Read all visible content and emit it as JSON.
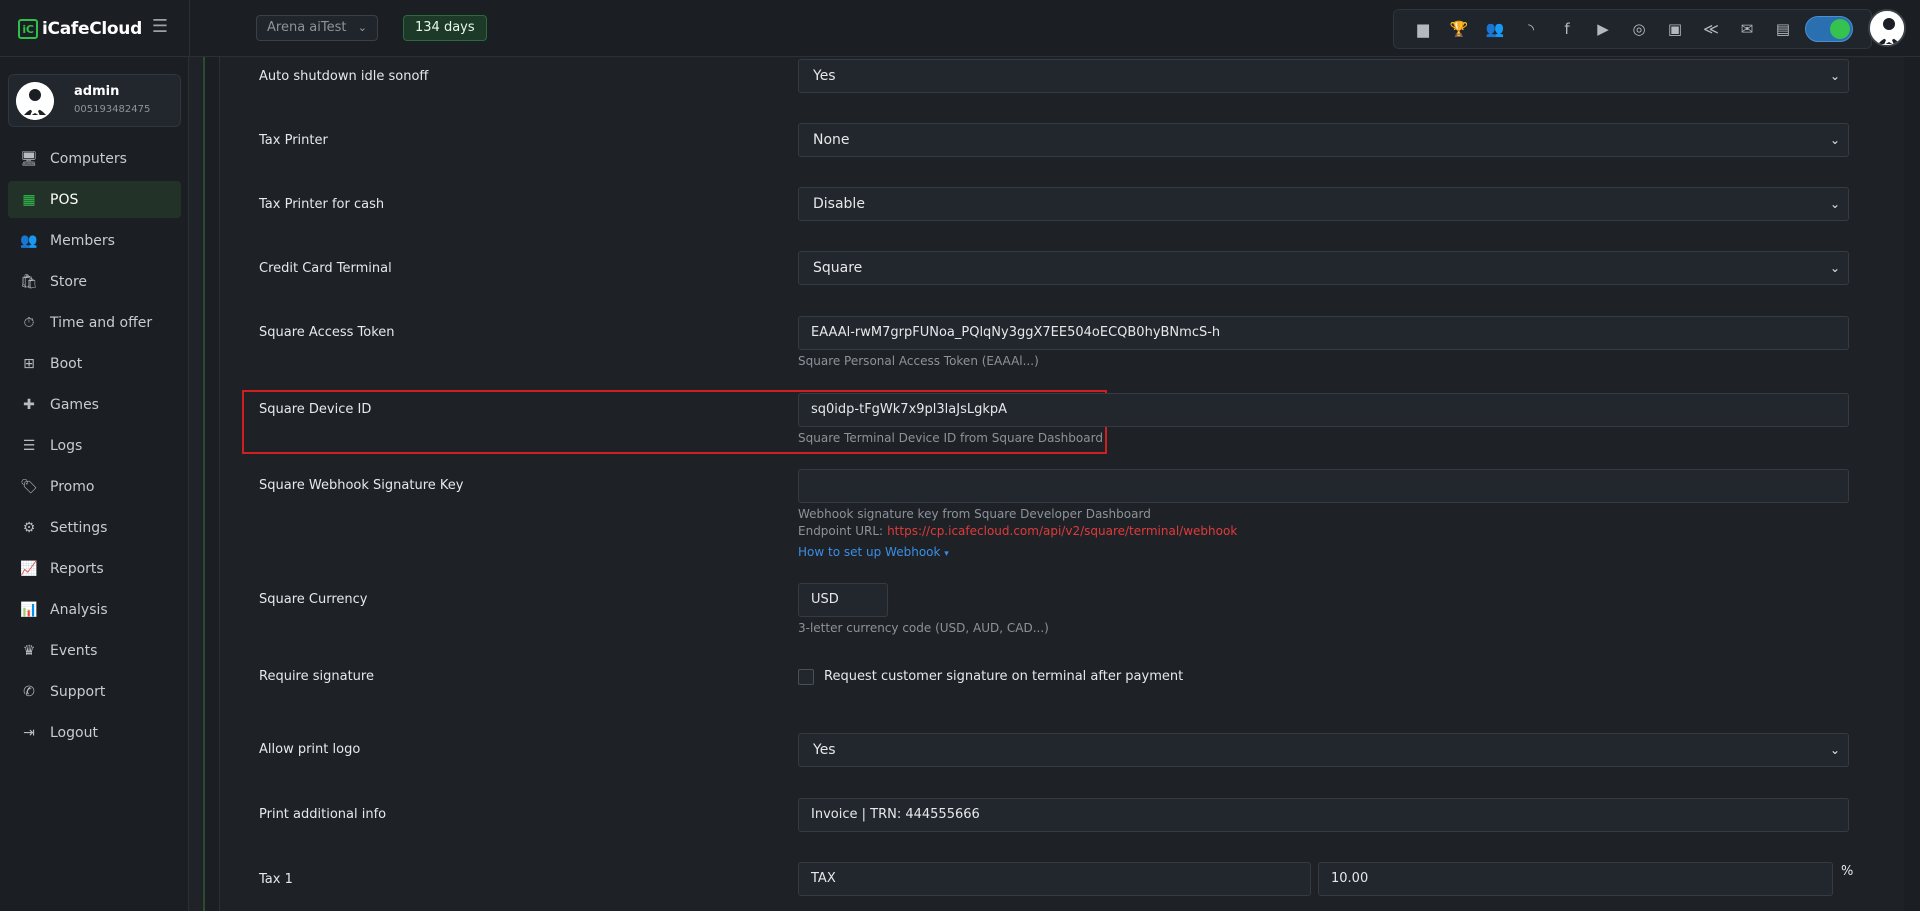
{
  "app": {
    "logo_mark": "iC",
    "logo_text": "iCafeCloud"
  },
  "topbar": {
    "shop_select": "Arena aiTest",
    "days_badge": "134 days",
    "icons": [
      "ranking-icon",
      "trophy-icon",
      "users-icon",
      "rss-icon",
      "facebook-icon",
      "youtube-icon",
      "globe-icon",
      "icafe-icon",
      "radar-icon",
      "mail-icon",
      "chat-icon"
    ],
    "toggle_on": true
  },
  "user": {
    "name": "admin",
    "id": "005193482475"
  },
  "nav": [
    {
      "label": "Computers",
      "icon": "monitor-icon",
      "glyph": "🖥"
    },
    {
      "label": "POS",
      "icon": "cash-register-icon",
      "glyph": "▦",
      "active": true
    },
    {
      "label": "Members",
      "icon": "members-icon",
      "glyph": "👥"
    },
    {
      "label": "Store",
      "icon": "bag-icon",
      "glyph": "🛍"
    },
    {
      "label": "Time and offer",
      "icon": "stopwatch-icon",
      "glyph": "⏱"
    },
    {
      "label": "Boot",
      "icon": "windows-icon",
      "glyph": "⊞"
    },
    {
      "label": "Games",
      "icon": "gamepad-icon",
      "glyph": "✚"
    },
    {
      "label": "Logs",
      "icon": "list-icon",
      "glyph": "☰"
    },
    {
      "label": "Promo",
      "icon": "tag-icon",
      "glyph": "🏷"
    },
    {
      "label": "Settings",
      "icon": "gear-icon",
      "glyph": "⚙"
    },
    {
      "label": "Reports",
      "icon": "line-chart-icon",
      "glyph": "📈"
    },
    {
      "label": "Analysis",
      "icon": "area-chart-icon",
      "glyph": "📊"
    },
    {
      "label": "Events",
      "icon": "crown-icon",
      "glyph": "♛"
    },
    {
      "label": "Support",
      "icon": "phone-icon",
      "glyph": "✆"
    },
    {
      "label": "Logout",
      "icon": "logout-icon",
      "glyph": "⇥"
    }
  ],
  "form": {
    "auto_shutdown": {
      "label": "Auto shutdown idle sonoff",
      "value": "Yes"
    },
    "tax_printer": {
      "label": "Tax Printer",
      "value": "None"
    },
    "tax_printer_cash": {
      "label": "Tax Printer for cash",
      "value": "Disable"
    },
    "credit_card_terminal": {
      "label": "Credit Card Terminal",
      "value": "Square"
    },
    "square_access_token": {
      "label": "Square Access Token",
      "value": "EAAAl-rwM7grpFUNoa_PQlqNy3ggX7EE504oECQB0hyBNmcS-h",
      "help": "Square Personal Access Token (EAAAl...)"
    },
    "square_device_id": {
      "label": "Square Device ID",
      "value": "sq0idp-tFgWk7x9pl3laJsLgkpA",
      "help": "Square Terminal Device ID from Square Dashboard"
    },
    "square_webhook_key": {
      "label": "Square Webhook Signature Key",
      "value": "",
      "help": "Webhook signature key from Square Developer Dashboard",
      "endpoint_label": "Endpoint URL:",
      "endpoint_url": "https://cp.icafecloud.com/api/v2/square/terminal/webhook",
      "howto": "How to set up Webhook"
    },
    "square_currency": {
      "label": "Square Currency",
      "value": "USD",
      "help": "3-letter currency code (USD, AUD, CAD...)"
    },
    "require_signature": {
      "label": "Require signature",
      "checkbox_label": "Request customer signature on terminal after payment",
      "checked": false
    },
    "allow_print_logo": {
      "label": "Allow print logo",
      "value": "Yes"
    },
    "print_additional_info": {
      "label": "Print additional info",
      "value": "Invoice | TRN: 444555666"
    },
    "tax1": {
      "label": "Tax 1",
      "name": "TAX",
      "rate": "10.00",
      "unit": "%"
    }
  },
  "colors": {
    "accent": "#2fbf4a",
    "highlight": "#d01f1f",
    "link": "#3a8ee6",
    "url": "#e03a3a"
  }
}
